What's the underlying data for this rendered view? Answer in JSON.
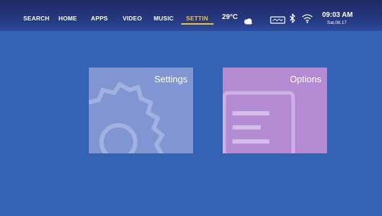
{
  "nav": {
    "items": [
      {
        "label": "SEARCH"
      },
      {
        "label": "HOME"
      },
      {
        "label": "APPS"
      },
      {
        "label": "VIDEO"
      },
      {
        "label": "MUSIC"
      },
      {
        "label": "SETTIN"
      }
    ],
    "active_index": 5
  },
  "weather": {
    "temperature": "29°C",
    "icon": "cloud-icon"
  },
  "status": {
    "icons": [
      "usb-icon",
      "bluetooth-icon",
      "wifi-icon"
    ]
  },
  "clock": {
    "time": "09:03 AM",
    "date": "Sat,08.17"
  },
  "tiles": [
    {
      "label": "Settings",
      "icon": "gear-icon",
      "color": "#8095d1"
    },
    {
      "label": "Options",
      "icon": "document-icon",
      "color": "#b48bd2"
    }
  ],
  "colors": {
    "background": "#3563b3",
    "accent": "#f3c23f"
  }
}
